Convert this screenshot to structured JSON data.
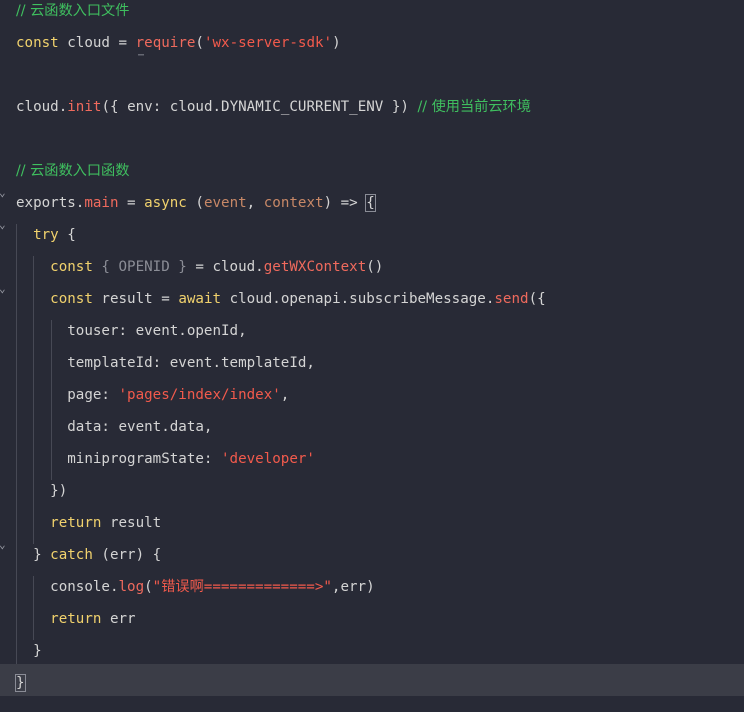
{
  "colors": {
    "background": "#282a36",
    "current_line": "#3b3d47",
    "comment": "#3fbf5f",
    "keyword": "#f1d26d",
    "function": "#ef6a5d",
    "string": "#f25a4c",
    "parameter": "#c88867",
    "text": "#d4d4d4",
    "dim": "#8b8d96"
  },
  "code": {
    "lines": [
      {
        "folded": false,
        "tokens": [
          {
            "t": "comment",
            "v": "// 云函数入口文件"
          }
        ]
      },
      {
        "folded": false,
        "tokens": [
          {
            "t": "kw",
            "v": "const"
          },
          {
            "t": "var",
            "v": " cloud "
          },
          {
            "t": "op",
            "v": "="
          },
          {
            "t": "var",
            "v": " "
          },
          {
            "t": "fn",
            "v": "require"
          },
          {
            "t": "punct",
            "v": "("
          },
          {
            "t": "str",
            "v": "'wx-server-sdk'"
          },
          {
            "t": "punct",
            "v": ")"
          }
        ]
      },
      {
        "folded": false,
        "tokens": []
      },
      {
        "folded": false,
        "tokens": [
          {
            "t": "var",
            "v": "cloud"
          },
          {
            "t": "punct",
            "v": "."
          },
          {
            "t": "fn",
            "v": "init"
          },
          {
            "t": "punct",
            "v": "({ "
          },
          {
            "t": "prop",
            "v": "env"
          },
          {
            "t": "punct",
            "v": ": "
          },
          {
            "t": "var",
            "v": "cloud.DYNAMIC_CURRENT_ENV"
          },
          {
            "t": "punct",
            "v": " }) "
          },
          {
            "t": "comment",
            "v": "// 使用当前云环境"
          }
        ]
      },
      {
        "folded": false,
        "tokens": []
      },
      {
        "folded": false,
        "tokens": [
          {
            "t": "comment",
            "v": "// 云函数入口函数"
          }
        ]
      },
      {
        "folded": true,
        "tokens": [
          {
            "t": "var",
            "v": "exports"
          },
          {
            "t": "punct",
            "v": "."
          },
          {
            "t": "fn",
            "v": "main"
          },
          {
            "t": "op",
            "v": " = "
          },
          {
            "t": "kw",
            "v": "async"
          },
          {
            "t": "punct",
            "v": " ("
          },
          {
            "t": "param",
            "v": "event"
          },
          {
            "t": "punct",
            "v": ", "
          },
          {
            "t": "param",
            "v": "context"
          },
          {
            "t": "punct",
            "v": ") => "
          },
          {
            "t": "hl",
            "v": "{"
          }
        ]
      },
      {
        "folded": true,
        "tokens": [
          {
            "t": "var",
            "v": "  "
          },
          {
            "t": "kw",
            "v": "try"
          },
          {
            "t": "punct",
            "v": " {"
          }
        ]
      },
      {
        "folded": false,
        "tokens": [
          {
            "t": "var",
            "v": "    "
          },
          {
            "t": "kw",
            "v": "const"
          },
          {
            "t": "dim",
            "v": " { OPENID } "
          },
          {
            "t": "op",
            "v": "="
          },
          {
            "t": "var",
            "v": " cloud."
          },
          {
            "t": "fn",
            "v": "getWXContext"
          },
          {
            "t": "punct",
            "v": "()"
          }
        ]
      },
      {
        "folded": true,
        "tokens": [
          {
            "t": "var",
            "v": "    "
          },
          {
            "t": "kw",
            "v": "const"
          },
          {
            "t": "var",
            "v": " result "
          },
          {
            "t": "op",
            "v": "="
          },
          {
            "t": "var",
            "v": " "
          },
          {
            "t": "kw",
            "v": "await"
          },
          {
            "t": "var",
            "v": " cloud.openapi.subscribeMessage."
          },
          {
            "t": "fn",
            "v": "send"
          },
          {
            "t": "punct",
            "v": "({"
          }
        ]
      },
      {
        "folded": false,
        "tokens": [
          {
            "t": "var",
            "v": "      touser: event.openId,"
          }
        ]
      },
      {
        "folded": false,
        "tokens": [
          {
            "t": "var",
            "v": "      templateId: event.templateId,"
          }
        ]
      },
      {
        "folded": false,
        "tokens": [
          {
            "t": "var",
            "v": "      page: "
          },
          {
            "t": "str",
            "v": "'pages/index/index'"
          },
          {
            "t": "punct",
            "v": ","
          }
        ]
      },
      {
        "folded": false,
        "tokens": [
          {
            "t": "var",
            "v": "      data: event.data,"
          }
        ]
      },
      {
        "folded": false,
        "tokens": [
          {
            "t": "var",
            "v": "      miniprogramState: "
          },
          {
            "t": "str",
            "v": "'developer'"
          }
        ]
      },
      {
        "folded": false,
        "tokens": [
          {
            "t": "var",
            "v": "    })"
          }
        ]
      },
      {
        "folded": false,
        "tokens": [
          {
            "t": "var",
            "v": "    "
          },
          {
            "t": "kw",
            "v": "return"
          },
          {
            "t": "var",
            "v": " result"
          }
        ]
      },
      {
        "folded": true,
        "tokens": [
          {
            "t": "var",
            "v": "  } "
          },
          {
            "t": "kw",
            "v": "catch"
          },
          {
            "t": "var",
            "v": " (err) {"
          }
        ]
      },
      {
        "folded": false,
        "tokens": [
          {
            "t": "var",
            "v": "    console."
          },
          {
            "t": "fn",
            "v": "log"
          },
          {
            "t": "punct",
            "v": "("
          },
          {
            "t": "str",
            "v": "\"错误啊=============>\""
          },
          {
            "t": "punct",
            "v": ",err)"
          }
        ]
      },
      {
        "folded": false,
        "tokens": [
          {
            "t": "var",
            "v": "    "
          },
          {
            "t": "kw",
            "v": "return"
          },
          {
            "t": "var",
            "v": " err"
          }
        ]
      },
      {
        "folded": false,
        "tokens": [
          {
            "t": "var",
            "v": "  }"
          }
        ]
      },
      {
        "folded": false,
        "current": true,
        "tokens": [
          {
            "t": "hl",
            "v": "}"
          }
        ]
      }
    ],
    "ellipsis": "⋯",
    "fold_icon": "chevron-down-icon"
  }
}
